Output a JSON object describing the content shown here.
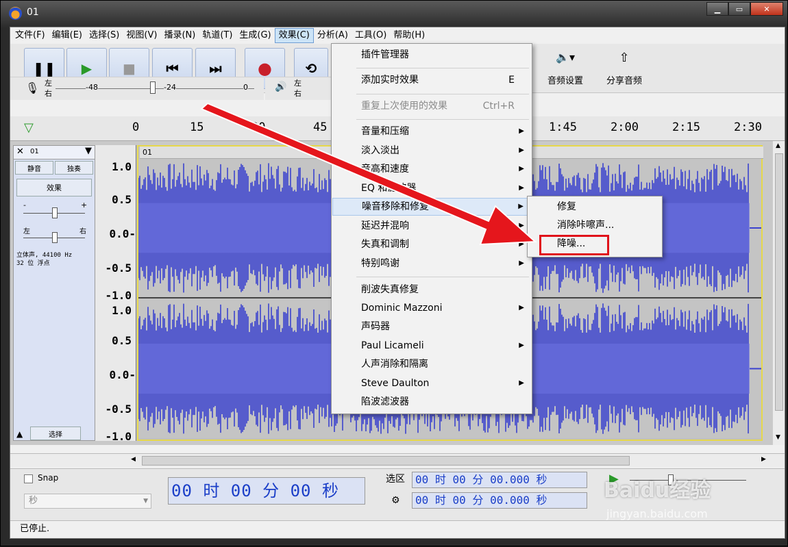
{
  "window": {
    "title": "01"
  },
  "menubar": [
    "文件(F)",
    "编辑(E)",
    "选择(S)",
    "视图(V)",
    "播录(N)",
    "轨道(T)",
    "生成(G)",
    "效果(C)",
    "分析(A)",
    "工具(O)",
    "帮助(H)"
  ],
  "toolbar": {
    "audio_setup_label": "音频设置",
    "share_audio_label": "分享音频"
  },
  "meters": {
    "rec_lr_top": "左",
    "rec_lr_bottom": "右",
    "rec_scale": [
      "-48",
      "-24",
      "0"
    ],
    "play_lr_top": "左",
    "play_lr_bottom": "右"
  },
  "ruler": {
    "ticks": [
      "0",
      "15",
      "30",
      "45",
      "1:45",
      "2:00",
      "2:15",
      "2:30"
    ]
  },
  "track": {
    "name": "01",
    "mute_label": "静音",
    "solo_label": "独奏",
    "effects_label": "效果",
    "gain_minus": "-",
    "gain_plus": "+",
    "pan_left": "左",
    "pan_right": "右",
    "info_line1": "立体声, 44100 Hz",
    "info_line2": "32 位 浮点",
    "select_label": "选择",
    "clip_name": "01",
    "y_labels_top": [
      "1.0",
      "0.5",
      "0.0-",
      "-0.5",
      "-1.0"
    ],
    "y_labels_bottom": [
      "1.0",
      "0.5",
      "0.0-",
      "-0.5",
      "-1.0"
    ]
  },
  "effects_menu": {
    "items": [
      {
        "label": "插件管理器",
        "key": "",
        "submenu": false,
        "disabled": false
      },
      {
        "label": "添加实时效果",
        "key": "E",
        "submenu": false,
        "disabled": false
      },
      {
        "label": "重复上次使用的效果",
        "key": "Ctrl+R",
        "submenu": false,
        "disabled": true
      },
      {
        "label": "音量和压缩",
        "key": "",
        "submenu": true,
        "disabled": false
      },
      {
        "label": "淡入淡出",
        "key": "",
        "submenu": true,
        "disabled": false
      },
      {
        "label": "音高和速度",
        "key": "",
        "submenu": true,
        "disabled": false
      },
      {
        "label": "EQ 和滤波器",
        "key": "",
        "submenu": true,
        "disabled": false
      },
      {
        "label": "噪音移除和修复",
        "key": "",
        "submenu": true,
        "disabled": false
      },
      {
        "label": "延迟并混响",
        "key": "",
        "submenu": true,
        "disabled": false
      },
      {
        "label": "失真和调制",
        "key": "",
        "submenu": true,
        "disabled": false
      },
      {
        "label": "特别鸣谢",
        "key": "",
        "submenu": true,
        "disabled": false
      },
      {
        "label": "削波失真修复",
        "key": "",
        "submenu": false,
        "disabled": false
      },
      {
        "label": "Dominic Mazzoni",
        "key": "",
        "submenu": true,
        "disabled": false
      },
      {
        "label": "声码器",
        "key": "",
        "submenu": false,
        "disabled": false
      },
      {
        "label": "Paul Licameli",
        "key": "",
        "submenu": true,
        "disabled": false
      },
      {
        "label": "人声消除和隔离",
        "key": "",
        "submenu": false,
        "disabled": false
      },
      {
        "label": "Steve Daulton",
        "key": "",
        "submenu": true,
        "disabled": false
      },
      {
        "label": "陷波滤波器",
        "key": "",
        "submenu": false,
        "disabled": false
      }
    ]
  },
  "noise_submenu": {
    "items": [
      "修复",
      "消除咔嚓声...",
      "降噪..."
    ]
  },
  "bottom": {
    "snap_label": "Snap",
    "snap_unit": "秒",
    "time_display": "00 时 00 分 00 秒",
    "selection_label": "选区",
    "sel_start": "00 时 00 分 00.000 秒",
    "sel_end": "00 时 00 分 00.000 秒"
  },
  "status": {
    "text": "已停止."
  },
  "watermark": {
    "line1": "Baidu经验",
    "line2": "jingyan.baidu.com"
  }
}
